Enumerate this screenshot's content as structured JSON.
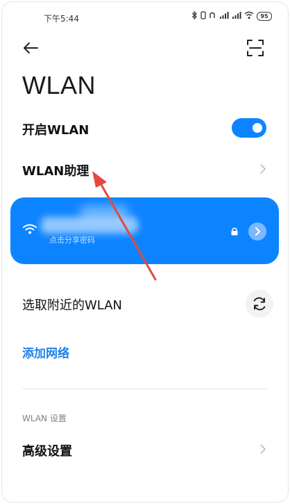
{
  "status_bar": {
    "time": "下午5:44",
    "icons_text": "✻ ▯ ◠ ",
    "signal_1": "▁▃▅▇",
    "signal_2": "▁▃▅▇",
    "battery": "95"
  },
  "header": {
    "title": "WLAN"
  },
  "wlan_toggle": {
    "label": "开启WLAN",
    "on": true
  },
  "assistant": {
    "label": "WLAN助理"
  },
  "connected_network": {
    "share_hint": "点击分享密码"
  },
  "nearby": {
    "label": "选取附近的WLAN"
  },
  "add_network": {
    "label": "添加网络"
  },
  "settings_section": {
    "header": "WLAN 设置",
    "advanced_label": "高级设置"
  },
  "colors": {
    "accent": "#0d84ff",
    "link": "#1e82e6",
    "annotation": "#e5483f"
  }
}
